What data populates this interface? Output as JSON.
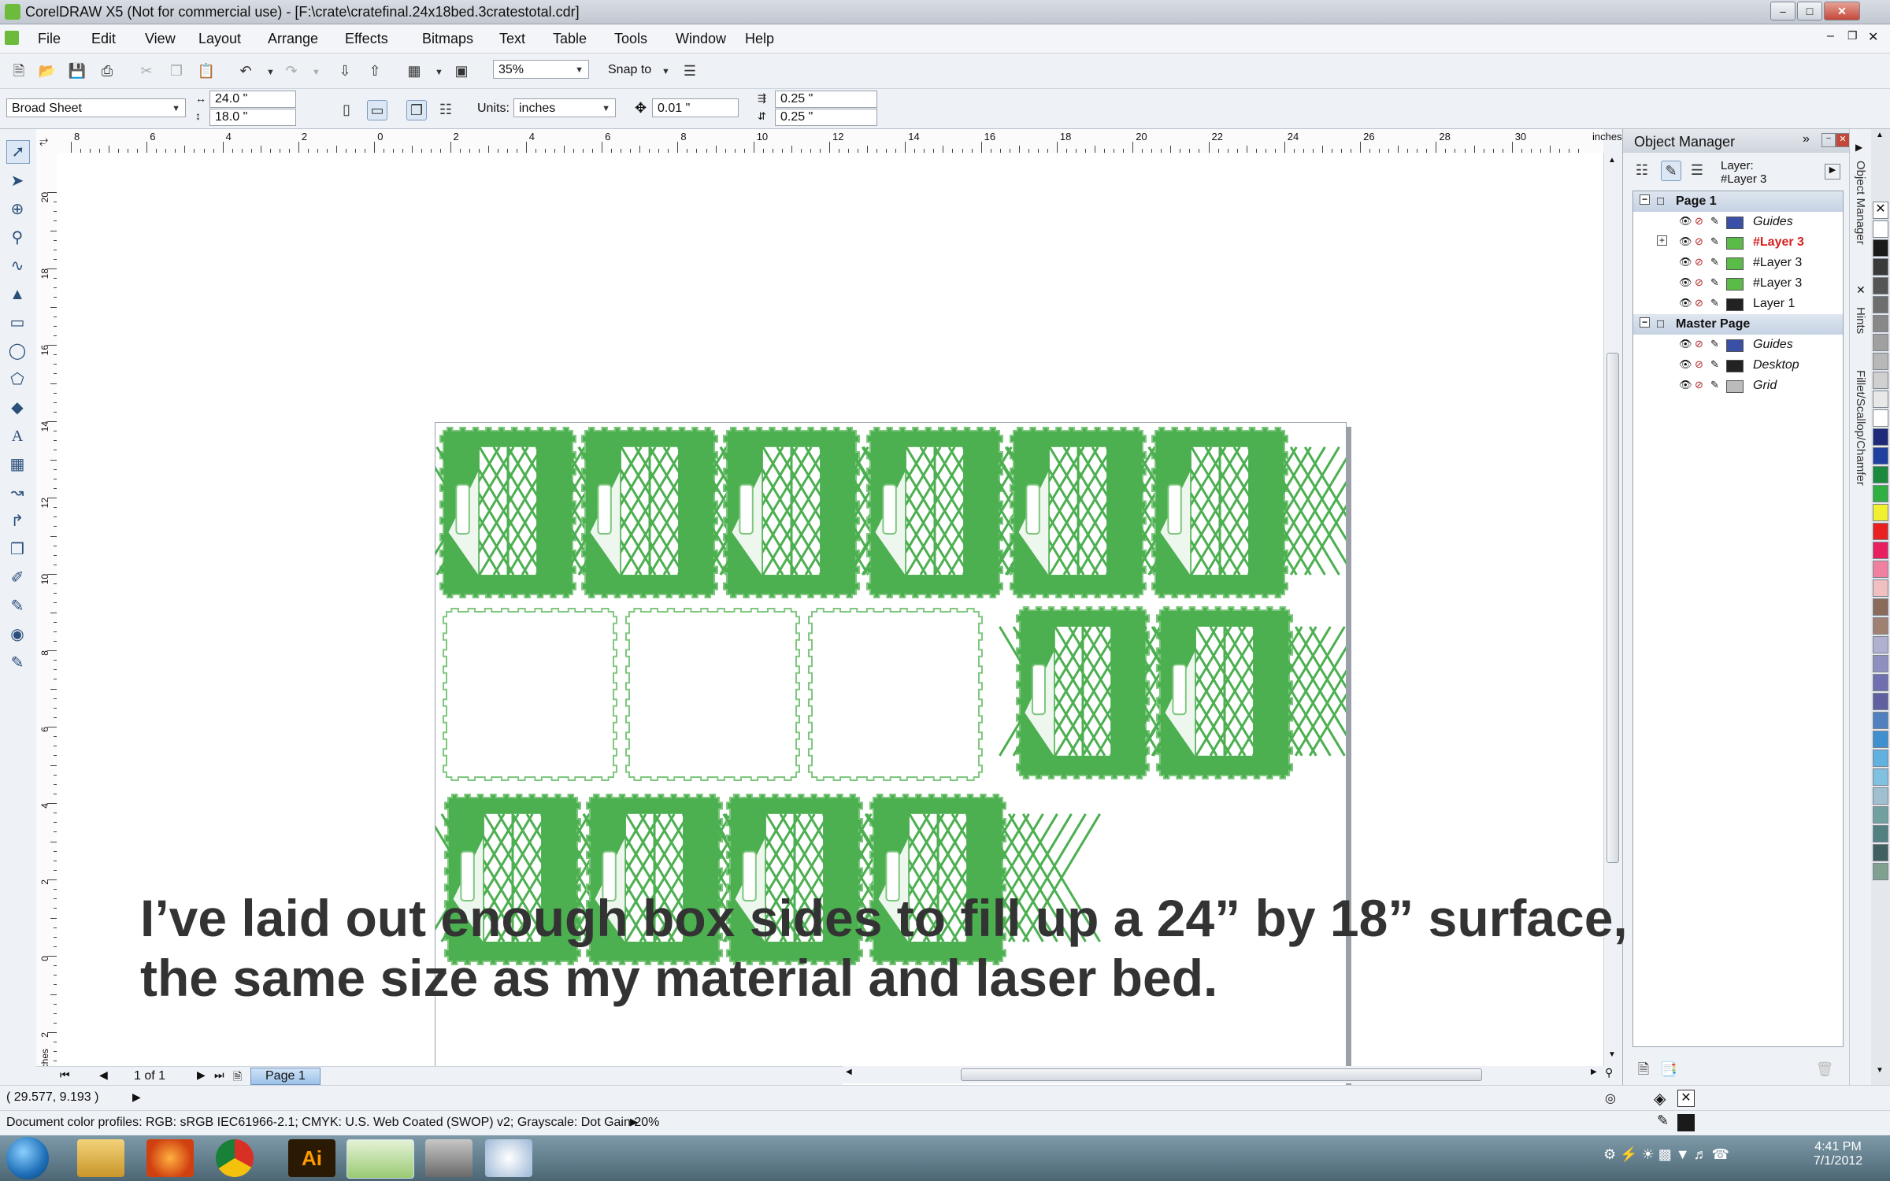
{
  "window": {
    "title": "CorelDRAW X5 (Not for commercial use) - [F:\\crate\\cratefinal.24x18bed.3cratestotal.cdr]"
  },
  "menu": [
    {
      "label": "File"
    },
    {
      "label": "Edit"
    },
    {
      "label": "View"
    },
    {
      "label": "Layout"
    },
    {
      "label": "Arrange"
    },
    {
      "label": "Effects"
    },
    {
      "label": "Bitmaps"
    },
    {
      "label": "Text"
    },
    {
      "label": "Table"
    },
    {
      "label": "Tools"
    },
    {
      "label": "Window"
    },
    {
      "label": "Help"
    }
  ],
  "toolbar": {
    "zoom": "35%",
    "snap_to": "Snap to"
  },
  "property_bar": {
    "page_size": "Broad Sheet",
    "width": "24.0 \"",
    "height": "18.0 \"",
    "units_label": "Units:",
    "units": "inches",
    "nudge": "0.01 \"",
    "dup_x": "0.25 \"",
    "dup_y": "0.25 \""
  },
  "ruler": {
    "h_ticks": [
      "8",
      "6",
      "4",
      "2",
      "0",
      "2",
      "4",
      "6",
      "8",
      "10",
      "12",
      "14",
      "16",
      "18",
      "20",
      "22",
      "24",
      "26",
      "28",
      "30"
    ],
    "h_unit": "inches",
    "v_ticks": [
      "20",
      "18",
      "16",
      "14",
      "12",
      "10",
      "8",
      "6",
      "4",
      "2",
      "0",
      "2"
    ],
    "v_unit": "inches"
  },
  "object_manager": {
    "title": "Object Manager",
    "layer_label": "Layer:",
    "layer_value": "#Layer 3",
    "rows": [
      {
        "label": "Page 1",
        "type": "page"
      },
      {
        "label": "Guides",
        "color": "#3a4fa6",
        "italic": true
      },
      {
        "label": "#Layer 3",
        "color": "#5bbb49",
        "active": true
      },
      {
        "label": "#Layer 3",
        "color": "#5bbb49"
      },
      {
        "label": "#Layer 3",
        "color": "#5bbb49"
      },
      {
        "label": "Layer 1",
        "color": "#222222"
      },
      {
        "label": "Master Page",
        "type": "page"
      },
      {
        "label": "Guides",
        "color": "#3a4fa6",
        "italic": true
      },
      {
        "label": "Desktop",
        "color": "#222222",
        "italic": true
      },
      {
        "label": "Grid",
        "color": "#bbbbbb",
        "italic": true
      }
    ]
  },
  "dock_tabs": [
    "Object Manager",
    "Hints",
    "Fillet/Scallop/Chamfer"
  ],
  "page_nav": {
    "counter": "1 of 1",
    "tab": "Page 1"
  },
  "status": {
    "coords": "( 29.577, 9.193 )",
    "color_profiles": "Document color profiles: RGB: sRGB IEC61966-2.1; CMYK: U.S. Web Coated (SWOP) v2; Grayscale: Dot Gain 20%"
  },
  "taskbar": {
    "time": "4:41 PM",
    "date": "7/1/2012"
  },
  "caption": {
    "line1": "I’ve laid out enough box sides to fill up a 24” by 18” surface,",
    "line2": "the same size as my material and laser bed."
  },
  "colors": {
    "crate_green": "#4caf50",
    "outline_green": "#7fc77f",
    "active_layer": "#d62020"
  },
  "palette": [
    "#ffffff",
    "#1a1a1a",
    "#3a3a3a",
    "#555555",
    "#6e6e6e",
    "#888888",
    "#a0a0a0",
    "#b8b8b8",
    "#d0d0d0",
    "#e8e8e8",
    "#ffffff",
    "#202a7a",
    "#2040a0",
    "#1c8a3c",
    "#30b040",
    "#f0f030",
    "#e82020",
    "#e82060",
    "#f080a0",
    "#f0c0c0",
    "#8a6a5a",
    "#a08070",
    "#b0b0d0",
    "#9090c0",
    "#7070b0",
    "#6060a0",
    "#5080c0",
    "#4090d0",
    "#60b0e0",
    "#80c0e0",
    "#a0c0d0",
    "#70a0a0",
    "#508080",
    "#406060",
    "#80a090"
  ]
}
